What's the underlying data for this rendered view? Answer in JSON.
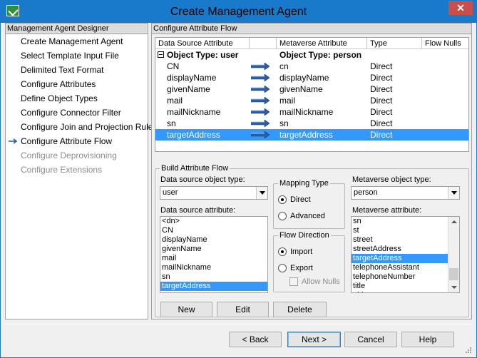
{
  "window": {
    "title": "Create Management Agent",
    "close_label": "✕"
  },
  "designer": {
    "header": "Management Agent Designer",
    "steps": [
      {
        "label": "Create Management Agent",
        "state": "enabled"
      },
      {
        "label": "Select Template Input File",
        "state": "enabled"
      },
      {
        "label": "Delimited Text Format",
        "state": "enabled"
      },
      {
        "label": "Configure Attributes",
        "state": "enabled"
      },
      {
        "label": "Define Object Types",
        "state": "enabled"
      },
      {
        "label": "Configure Connector Filter",
        "state": "enabled"
      },
      {
        "label": "Configure Join and Projection Rules",
        "state": "enabled"
      },
      {
        "label": "Configure Attribute Flow",
        "state": "current"
      },
      {
        "label": "Configure Deprovisioning",
        "state": "disabled"
      },
      {
        "label": "Configure Extensions",
        "state": "disabled"
      }
    ]
  },
  "attribute_flow": {
    "header": "Configure Attribute Flow",
    "columns": [
      "Data Source Attribute",
      "",
      "Metaverse Attribute",
      "Type",
      "Flow Nulls"
    ],
    "group": {
      "source": "Object Type: user",
      "metaverse": "Object Type: person"
    },
    "rows": [
      {
        "source": "CN",
        "metaverse": "cn",
        "type": "Direct"
      },
      {
        "source": "displayName",
        "metaverse": "displayName",
        "type": "Direct"
      },
      {
        "source": "givenName",
        "metaverse": "givenName",
        "type": "Direct"
      },
      {
        "source": "mail",
        "metaverse": "mail",
        "type": "Direct"
      },
      {
        "source": "mailNickname",
        "metaverse": "mailNickname",
        "type": "Direct"
      },
      {
        "source": "sn",
        "metaverse": "sn",
        "type": "Direct"
      },
      {
        "source": "targetAddress",
        "metaverse": "targetAddress",
        "type": "Direct",
        "selected": true
      }
    ]
  },
  "build": {
    "title": "Build Attribute Flow",
    "ds_object_type_label": "Data source object type:",
    "ds_object_type_value": "user",
    "ds_attribute_label": "Data source attribute:",
    "ds_attributes": [
      "<dn>",
      "CN",
      "displayName",
      "givenName",
      "mail",
      "mailNickname",
      "sn",
      "targetAddress"
    ],
    "ds_attribute_selected": "targetAddress",
    "mapping_type_title": "Mapping Type",
    "mapping_direct": "Direct",
    "mapping_advanced": "Advanced",
    "mapping_selected": "Direct",
    "flow_direction_title": "Flow Direction",
    "flow_import": "Import",
    "flow_export": "Export",
    "flow_selected": "Import",
    "allow_nulls": "Allow Nulls",
    "mv_object_type_label": "Metaverse object type:",
    "mv_object_type_value": "person",
    "mv_attribute_label": "Metaverse attribute:",
    "mv_attributes": [
      "sn",
      "st",
      "street",
      "streetAddress",
      "targetAddress",
      "telephoneAssistant",
      "telephoneNumber",
      "title",
      "uid"
    ],
    "mv_attribute_selected": "targetAddress",
    "new_label": "New",
    "edit_label": "Edit",
    "delete_label": "Delete"
  },
  "footer": {
    "back_label": "< Back",
    "next_label": "Next >",
    "cancel_label": "Cancel",
    "help_label": "Help"
  },
  "colors": {
    "title_bar": "#1979ca",
    "selection": "#3399ff",
    "close_button": "#c7504b"
  },
  "icons": {
    "app": "green-check-icon",
    "current_step": "right-arrow-icon",
    "flow": "import-arrow-icon"
  }
}
